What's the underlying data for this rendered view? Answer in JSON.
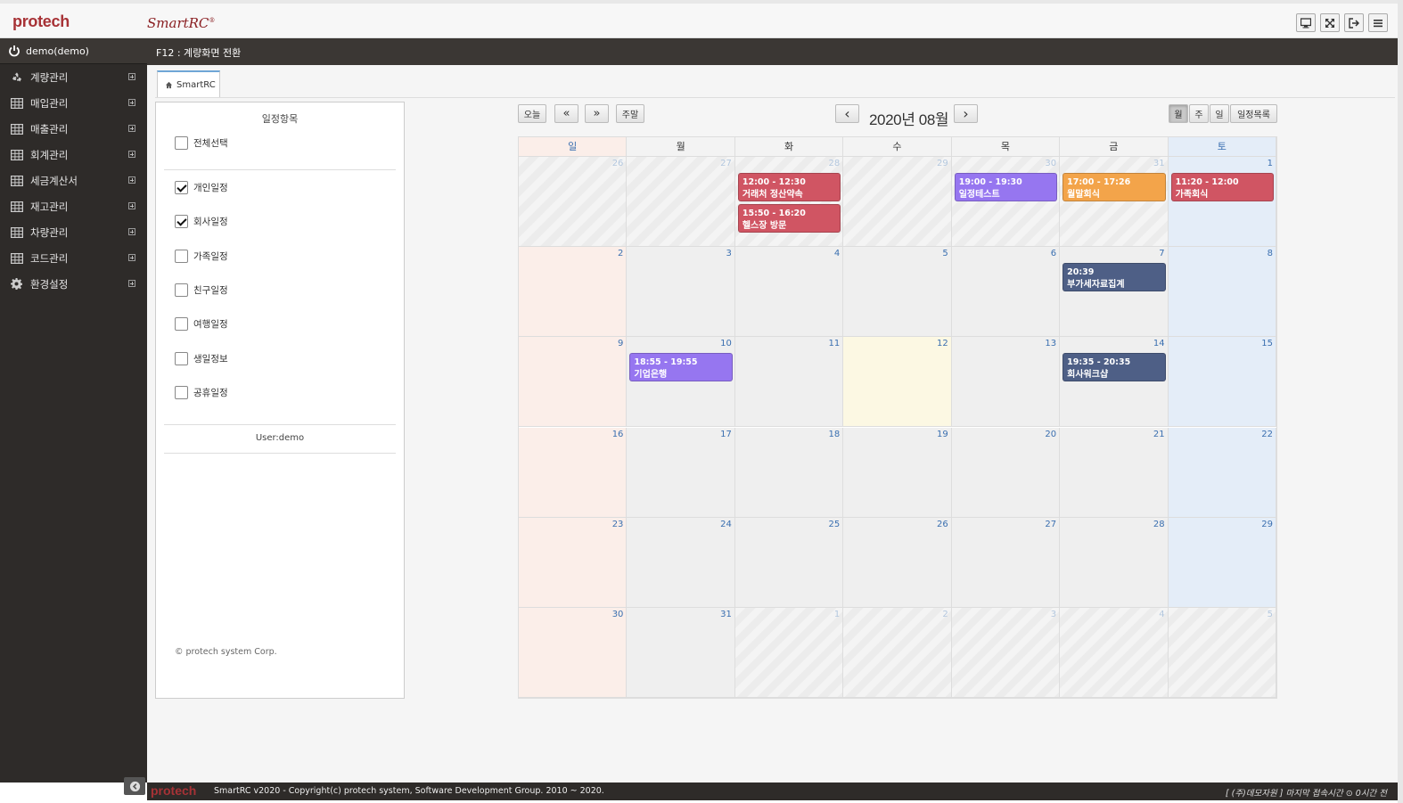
{
  "header": {
    "logo": "protech",
    "brand": "SmartRC",
    "brand_mark": "®"
  },
  "sidebar": {
    "user": "demo(demo)",
    "items": [
      {
        "label": "계량관리",
        "icon": "recycle-icon"
      },
      {
        "label": "매입관리",
        "icon": "table-icon"
      },
      {
        "label": "매출관리",
        "icon": "table-icon"
      },
      {
        "label": "회계관리",
        "icon": "table-icon"
      },
      {
        "label": "세금계산서",
        "icon": "table-icon"
      },
      {
        "label": "재고관리",
        "icon": "table-icon"
      },
      {
        "label": "차량관리",
        "icon": "table-icon"
      },
      {
        "label": "코드관리",
        "icon": "table-icon"
      },
      {
        "label": "환경설정",
        "icon": "gear-icon"
      }
    ]
  },
  "subbar": {
    "text": "F12 : 계량화면 전환"
  },
  "tab": {
    "label": "SmartRC"
  },
  "panel": {
    "title": "일정항목",
    "select_all": {
      "label": "전체선택",
      "checked": false
    },
    "categories": [
      {
        "label": "개인일정",
        "checked": true
      },
      {
        "label": "회사일정",
        "checked": true
      },
      {
        "label": "가족일정",
        "checked": false
      },
      {
        "label": "친구일정",
        "checked": false
      },
      {
        "label": "여행일정",
        "checked": false
      },
      {
        "label": "생일정보",
        "checked": false
      },
      {
        "label": "공휴일정",
        "checked": false
      }
    ],
    "user": "User:demo",
    "corp": "© protech system Corp."
  },
  "calendar": {
    "title": "2020년 08월",
    "buttons": {
      "today": "오늘",
      "prev_year": "«",
      "next_year": "»",
      "weekend": "주말",
      "prev": "‹",
      "next": "›",
      "month": "월",
      "week": "주",
      "day": "일",
      "list": "일정목록"
    },
    "weekdays": [
      "일",
      "월",
      "화",
      "수",
      "목",
      "금",
      "토"
    ],
    "weeks": [
      [
        26,
        27,
        28,
        29,
        30,
        31,
        1
      ],
      [
        2,
        3,
        4,
        5,
        6,
        7,
        8
      ],
      [
        9,
        10,
        11,
        12,
        13,
        14,
        15
      ],
      [
        16,
        17,
        18,
        19,
        20,
        21,
        22
      ],
      [
        23,
        24,
        25,
        26,
        27,
        28,
        29
      ],
      [
        30,
        31,
        1,
        2,
        3,
        4,
        5
      ]
    ],
    "today": {
      "week": 2,
      "day": 3
    },
    "colors": {
      "red": "#d05563",
      "purple": "#9676f0",
      "orange": "#f3a44a",
      "navy": "#4e5f86"
    },
    "events": [
      {
        "week": 0,
        "day": 2,
        "slot": 0,
        "time": "12:00 - 12:30",
        "title": "거래처 정산약속",
        "color": "red"
      },
      {
        "week": 0,
        "day": 2,
        "slot": 1,
        "time": "15:50 - 16:20",
        "title": "헬스장 방문",
        "color": "red"
      },
      {
        "week": 0,
        "day": 4,
        "slot": 0,
        "time": "19:00 - 19:30",
        "title": "일정테스트",
        "color": "purple"
      },
      {
        "week": 0,
        "day": 5,
        "slot": 0,
        "time": "17:00 - 17:26",
        "title": "월말회식",
        "color": "orange"
      },
      {
        "week": 0,
        "day": 6,
        "slot": 0,
        "time": "11:20 - 12:00",
        "title": "가족회식",
        "color": "red"
      },
      {
        "week": 1,
        "day": 5,
        "slot": 0,
        "time": "20:39",
        "title": "부가세자료집계",
        "color": "navy"
      },
      {
        "week": 2,
        "day": 1,
        "slot": 0,
        "time": "18:55 - 19:55",
        "title": "기업은행",
        "color": "purple"
      },
      {
        "week": 2,
        "day": 5,
        "slot": 0,
        "time": "19:35 - 20:35",
        "title": "회사워크샵",
        "color": "navy"
      }
    ]
  },
  "footer": {
    "logo": "protech",
    "copyright": "SmartRC v2020 - Copyright(c) protech system, Software Development Group. 2010 ~ 2020.",
    "last_access": "[ (주)데모자원 ] 마지막 접속시간 ⊙ 0시간 전"
  }
}
